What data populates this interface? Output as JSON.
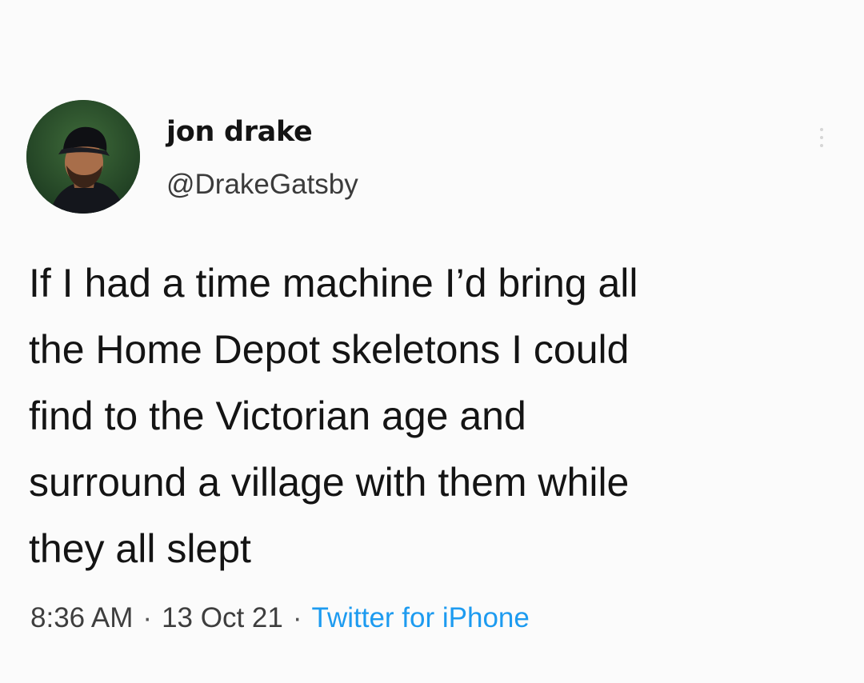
{
  "tweet": {
    "author": {
      "display_name": "jon drake",
      "handle": "@DrakeGatsby",
      "avatar": "profile-photo"
    },
    "text": "If I had a time machine I’d bring all\nthe Home Depot skeletons I could\nfind to the Victorian age and\nsurround a village with them while\nthey all slept",
    "meta": {
      "time": "8:36 AM",
      "separator": "·",
      "date": "13 Oct 21",
      "source": "Twitter for iPhone"
    },
    "more_icon": "more-vertical-icon"
  },
  "colors": {
    "background": "#fbfbfb",
    "text": "#141414",
    "secondary_text": "#3e3e3e",
    "link": "#1d9bf0"
  }
}
